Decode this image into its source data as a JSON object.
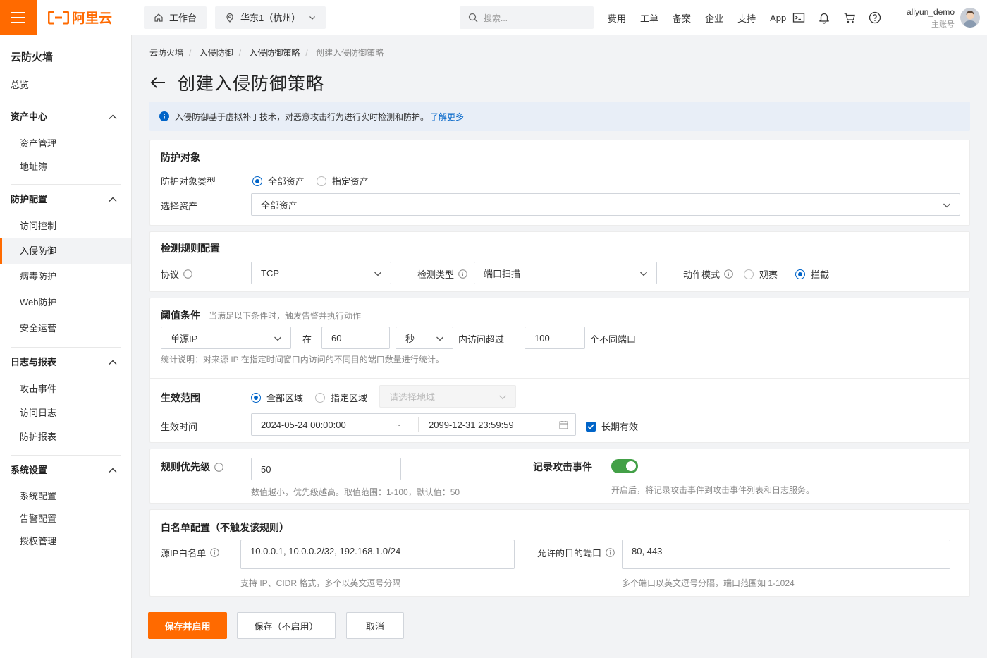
{
  "topbar": {
    "logo_text": "阿里云",
    "workbench": "工作台",
    "region": "华东1（杭州）",
    "search_placeholder": "搜索...",
    "links": [
      "费用",
      "工单",
      "备案",
      "企业",
      "支持",
      "App"
    ],
    "username": "aliyun_demo",
    "account_type": "主账号"
  },
  "sidebar": {
    "title": "云防火墙",
    "overview": "总览",
    "groups": [
      {
        "label": "资产中心",
        "items": [
          "资产管理",
          "地址簿"
        ]
      },
      {
        "label": "防护配置",
        "items": [
          "访问控制",
          "入侵防御",
          "病毒防护",
          "Web防护",
          "安全运营"
        ]
      },
      {
        "label": "日志与报表",
        "items": [
          "攻击事件",
          "访问日志",
          "防护报表"
        ]
      },
      {
        "label": "系统设置",
        "items": [
          "系统配置",
          "告警配置",
          "授权管理"
        ]
      }
    ],
    "active": "入侵防御"
  },
  "breadcrumb": [
    "云防火墙",
    "入侵防御",
    "入侵防御策略",
    "创建入侵防御策略"
  ],
  "page_title": "创建入侵防御策略",
  "notice": {
    "text": "入侵防御基于虚拟补丁技术，对恶意攻击行为进行实时检测和防护。",
    "link": "了解更多"
  },
  "protect_target": {
    "title": "防护对象",
    "type_label": "防护对象类型",
    "type_options": [
      "全部资产",
      "指定资产"
    ],
    "type_selected": "全部资产",
    "asset_label": "选择资产",
    "asset_value": "全部资产"
  },
  "detect_rule": {
    "title": "检测规则配置",
    "protocol_label": "协议",
    "protocol_value": "TCP",
    "detect_type_label": "检测类型",
    "detect_type_value": "端口扫描",
    "action_label": "动作模式",
    "action_options": [
      "观察",
      "拦截"
    ],
    "action_selected": "拦截"
  },
  "threshold": {
    "title": "阈值条件",
    "subtitle": "当满足以下条件时，触发告警并执行动作",
    "source_value": "单源IP",
    "in_text": "在",
    "window_value": "60",
    "unit_value": "秒",
    "access_text": "内访问超过",
    "count_value": "100",
    "ports_text": "个不同端口",
    "note": "统计说明：对来源 IP 在指定时间窗口内访问的不同目的端口数量进行统计。"
  },
  "scope": {
    "title": "生效范围",
    "options": [
      "全部区域",
      "指定区域"
    ],
    "selected": "全部区域",
    "region_placeholder": "请选择地域",
    "time_label": "生效时间",
    "start_time": "2024-05-24 00:00:00",
    "tilde": "~",
    "end_time": "2099-12-31 23:59:59",
    "long_term_label": "长期有效",
    "long_term_checked": true
  },
  "priority": {
    "title": "规则优先级",
    "value": "50",
    "hint": "数值越小，优先级越高。取值范围：1-100，默认值：50"
  },
  "record": {
    "title": "记录攻击事件",
    "enabled": true,
    "hint": "开启后，将记录攻击事件到攻击事件列表和日志服务。"
  },
  "whitelist": {
    "title": "白名单配置（不触发该规则）",
    "src_label": "源IP白名单",
    "src_value": "10.0.0.1, 10.0.0.2/32, 192.168.1.0/24",
    "src_hint": "支持 IP、CIDR 格式，多个以英文逗号分隔",
    "port_label": "允许的目的端口",
    "port_value": "80, 443",
    "port_hint": "多个端口以英文逗号分隔，端口范围如 1-1024"
  },
  "actions": {
    "save_enable": "保存并启用",
    "save_disable": "保存（不启用）",
    "cancel": "取消"
  },
  "colors": {
    "brand": "#ff6a00",
    "primary_blue": "#0064c8",
    "toggle_on": "#43a047"
  }
}
